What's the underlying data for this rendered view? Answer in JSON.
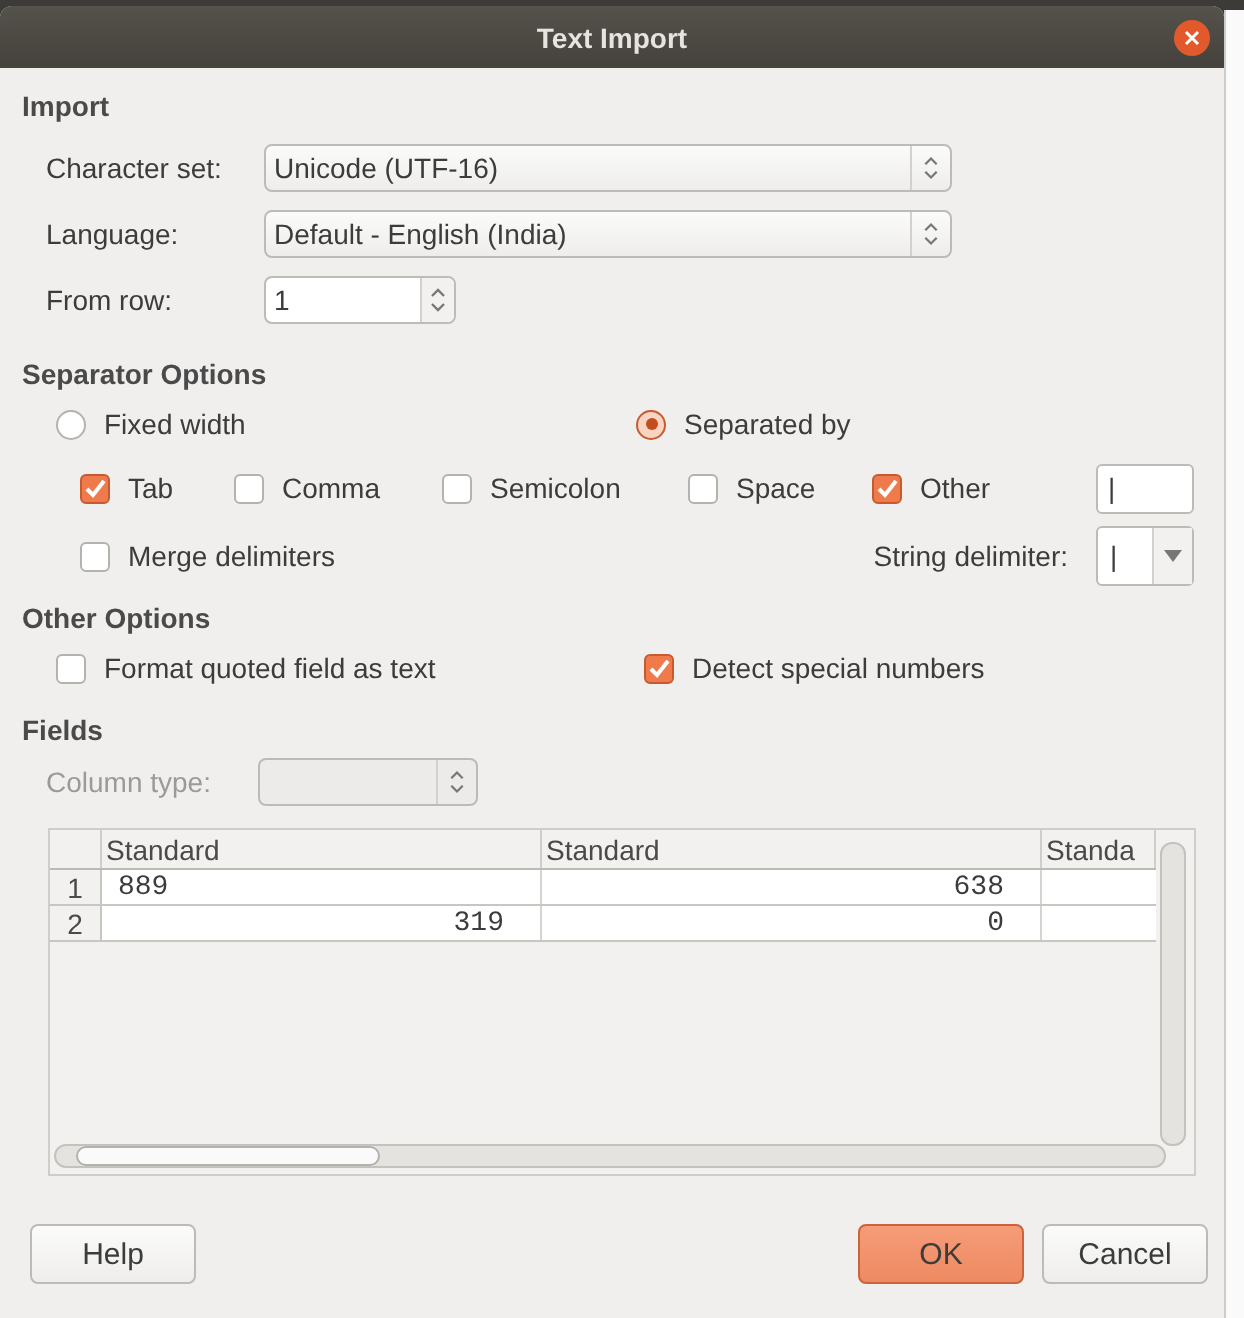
{
  "window": {
    "title": "Text Import"
  },
  "import": {
    "heading": "Import",
    "character_set": {
      "label": "Character set:",
      "value": "Unicode (UTF-16)"
    },
    "language": {
      "label": "Language:",
      "value": "Default - English (India)"
    },
    "from_row": {
      "label": "From row:",
      "value": "1"
    }
  },
  "separator_options": {
    "heading": "Separator Options",
    "modes": [
      {
        "label": "Fixed width",
        "selected": false
      },
      {
        "label": "Separated by",
        "selected": true
      }
    ],
    "separators": [
      {
        "label": "Tab",
        "checked": true
      },
      {
        "label": "Comma",
        "checked": false
      },
      {
        "label": "Semicolon",
        "checked": false
      },
      {
        "label": "Space",
        "checked": false
      },
      {
        "label": "Other",
        "checked": true
      }
    ],
    "other_value": "|",
    "merge_delimiters": {
      "label": "Merge delimiters",
      "checked": false
    },
    "string_delimiter": {
      "label": "String delimiter:",
      "value": "|"
    }
  },
  "other_options": {
    "heading": "Other Options",
    "items": [
      {
        "label": "Format quoted field as text",
        "checked": false
      },
      {
        "label": "Detect special numbers",
        "checked": true
      }
    ]
  },
  "fields": {
    "heading": "Fields",
    "column_type": {
      "label": "Column type:",
      "disabled": true
    },
    "columns": [
      "Standard",
      "Standard",
      "Standa"
    ],
    "rows": [
      {
        "number": "1",
        "cells": [
          {
            "text": "889",
            "kind": "left"
          },
          {
            "text": "638",
            "kind": "right"
          }
        ]
      },
      {
        "number": "2",
        "cells": [
          {
            "text": "319",
            "kind": "right"
          },
          {
            "text": "0",
            "kind": "right"
          }
        ]
      }
    ]
  },
  "buttons": [
    {
      "label": "Help",
      "kind": "plain"
    },
    {
      "label": "OK",
      "kind": "default"
    },
    {
      "label": "Cancel",
      "kind": "plain"
    }
  ]
}
